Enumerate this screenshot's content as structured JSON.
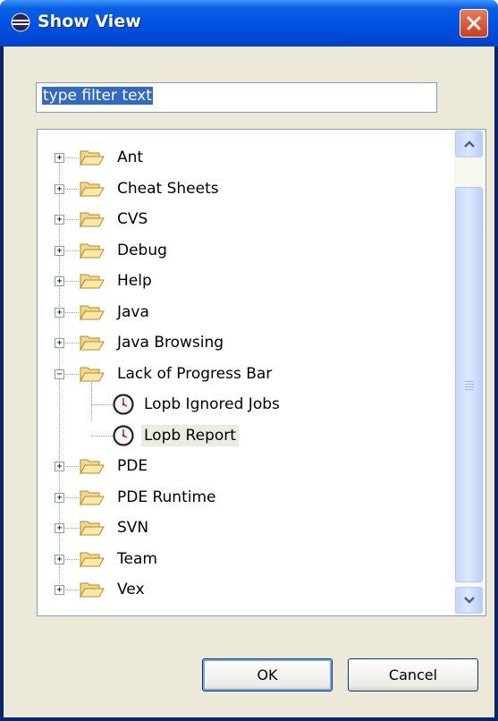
{
  "window": {
    "title": "Show View"
  },
  "filter": {
    "text": "type filter text"
  },
  "tree": {
    "items": [
      {
        "label": "Ant",
        "expanded": false
      },
      {
        "label": "Cheat Sheets",
        "expanded": false
      },
      {
        "label": "CVS",
        "expanded": false
      },
      {
        "label": "Debug",
        "expanded": false
      },
      {
        "label": "Help",
        "expanded": false
      },
      {
        "label": "Java",
        "expanded": false
      },
      {
        "label": "Java Browsing",
        "expanded": false
      },
      {
        "label": "Lack of Progress Bar",
        "expanded": true,
        "children": [
          {
            "label": "Lopb Ignored Jobs"
          },
          {
            "label": "Lopb Report",
            "selected": true
          }
        ]
      },
      {
        "label": "PDE",
        "expanded": false
      },
      {
        "label": "PDE Runtime",
        "expanded": false
      },
      {
        "label": "SVN",
        "expanded": false
      },
      {
        "label": "Team",
        "expanded": false
      },
      {
        "label": "Vex",
        "expanded": false
      }
    ]
  },
  "buttons": {
    "ok": "OK",
    "cancel": "Cancel"
  },
  "icons": {
    "title": "eclipse-icon",
    "folder": "folder-open-icon",
    "view": "clock-icon",
    "close": "close-icon"
  },
  "colors": {
    "titlebar": "#0055e5",
    "dialog_bg": "#ece9d8",
    "selection": "#316ac5",
    "close": "#e0582f"
  }
}
